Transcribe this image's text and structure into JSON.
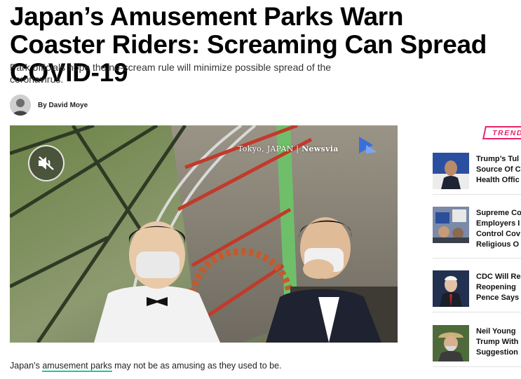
{
  "article": {
    "headline": "Japan’s Amusement Parks Warn Coaster Riders: Screaming Can Spread COVID-19",
    "subhead": "Park officials hope the no-scream rule will minimize possible spread of the coronavirus.",
    "byline": "By David Moye",
    "body_intro_before": "Japan’s ",
    "body_link": "amusement parks",
    "body_intro_after": " may not be as amusing as they used to be."
  },
  "video": {
    "watermark_location": "Tokyo, JAPAN",
    "watermark_separator": " | ",
    "watermark_brand": "Newsvia",
    "mute_icon": "speaker-muted-icon"
  },
  "sidebar": {
    "badge": "TRENDING",
    "items": [
      {
        "lines": [
          "Trump’s Tul",
          "Source Of C",
          "Health Offic"
        ]
      },
      {
        "lines": [
          "Supreme Co",
          "Employers I",
          "Control Cov",
          "Religious O"
        ]
      },
      {
        "lines": [
          "CDC Will Re",
          "Reopening",
          "Pence Says"
        ]
      },
      {
        "lines": [
          "Neil Young",
          "Trump With",
          "Suggestion"
        ]
      }
    ]
  },
  "colors": {
    "link_underline": "#1cc8a0",
    "trending_accent": "#e8246b"
  }
}
